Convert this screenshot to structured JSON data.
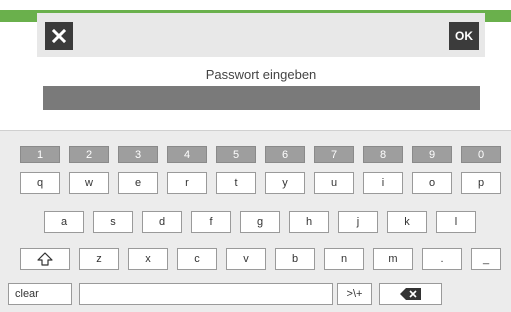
{
  "dialog": {
    "ok_label": "OK",
    "prompt": "Passwort eingeben",
    "password_value": ""
  },
  "keyboard": {
    "numbers": [
      "1",
      "2",
      "3",
      "4",
      "5",
      "6",
      "7",
      "8",
      "9",
      "0"
    ],
    "row1": [
      "q",
      "w",
      "e",
      "r",
      "t",
      "y",
      "u",
      "i",
      "o",
      "p"
    ],
    "row2": [
      "a",
      "s",
      "d",
      "f",
      "g",
      "h",
      "j",
      "k",
      "l"
    ],
    "row3": [
      "z",
      "x",
      "c",
      "v",
      "b",
      "n",
      "m",
      ".",
      "_"
    ],
    "clear_label": "clear",
    "symbols_label": ">\\+"
  },
  "icons": {
    "close": "close-icon",
    "shift": "shift-icon",
    "backspace": "backspace-icon"
  },
  "colors": {
    "accent_green": "#6ab04c",
    "dark_button": "#3b3b3b",
    "field_gray": "#7a7a7a",
    "number_key": "#9e9e9e"
  }
}
